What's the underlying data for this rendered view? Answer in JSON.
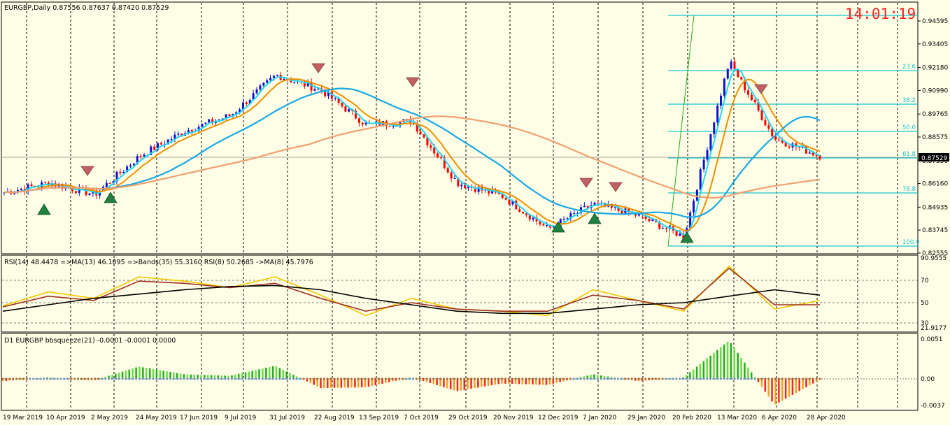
{
  "main": {
    "title": "EURGBP,Daily  0.87556 0.87637 0.87420 0.87529",
    "clock": "14:01:19",
    "current_price": "0.87529",
    "price_ticks": [
      "0.94595",
      "0.93405",
      "0.92180",
      "0.90990",
      "0.89765",
      "0.88575",
      "0.87350",
      "0.86160",
      "0.84935",
      "0.83745",
      "0.82555"
    ],
    "fib_levels": [
      "23.6",
      "38.2",
      "50.0",
      "61.8",
      "76.8",
      "100.0"
    ]
  },
  "rsi_panel": {
    "label": "RSI(14) 48.4478  =>MA(13) 46.1095  =>Bands(35) 55.3160  RSI(8) 50.2685  ->MA(8) 45.7976",
    "ticks": [
      "90.9555",
      "70",
      "50",
      "30",
      "21.9177"
    ]
  },
  "squeeze_panel": {
    "label": "D1 EURGBP bbsqueeze(21) -0.0001 -0.0001 0.0000",
    "ticks": [
      "0.0051",
      "0.00",
      "-0.0037"
    ]
  },
  "time_axis": [
    "19 Mar 2019",
    "10 Apr 2019",
    "2 May 2019",
    "24 May 2019",
    "17 Jun 2019",
    "9 Jul 2019",
    "31 Jul 2019",
    "22 Aug 2019",
    "13 Sep 2019",
    "7 Oct 2019",
    "29 Oct 2019",
    "20 Nov 2019",
    "12 Dec 2019",
    "7 Jan 2020",
    "29 Jan 2020",
    "20 Feb 2020",
    "13 Mar 2020",
    "6 Apr 2020",
    "28 Apr 2020"
  ],
  "colors": {
    "bull": "#1010d0",
    "bear": "#ff0000",
    "ma_fast": "#20d8f0",
    "ma_mid": "#f09000",
    "ma_long": "#1aa8e6",
    "ma_slow": "#f0a070",
    "fib": "#19c3d2",
    "rsi": "#f0c800",
    "rsi_ma": "#a03020",
    "rsi_bands": "#000000"
  },
  "chart_data": [
    {
      "type": "candlestick",
      "symbol": "EURGBP",
      "timeframe": "Daily",
      "ylim": [
        0.82555,
        0.94595
      ],
      "x": [
        "19 Mar 2019",
        "10 Apr 2019",
        "2 May 2019",
        "24 May 2019",
        "17 Jun 2019",
        "9 Jul 2019",
        "31 Jul 2019",
        "22 Aug 2019",
        "13 Sep 2019",
        "7 Oct 2019",
        "29 Oct 2019",
        "20 Nov 2019",
        "12 Dec 2019",
        "7 Jan 2020",
        "29 Jan 2020",
        "20 Feb 2020",
        "13 Mar 2020",
        "6 Apr 2020",
        "28 Apr 2020"
      ],
      "close": [
        0.857,
        0.862,
        0.856,
        0.876,
        0.889,
        0.897,
        0.918,
        0.91,
        0.892,
        0.894,
        0.862,
        0.855,
        0.838,
        0.851,
        0.845,
        0.834,
        0.925,
        0.885,
        0.876
      ]
    },
    {
      "type": "line",
      "title": "RSI(14)",
      "ylim": [
        21.9177,
        90.9555
      ],
      "x": [
        "19 Mar 2019",
        "10 Apr 2019",
        "2 May 2019",
        "24 May 2019",
        "17 Jun 2019",
        "9 Jul 2019",
        "31 Jul 2019",
        "22 Aug 2019",
        "13 Sep 2019",
        "7 Oct 2019",
        "29 Oct 2019",
        "20 Nov 2019",
        "12 Dec 2019",
        "7 Jan 2020",
        "29 Jan 2020",
        "20 Feb 2020",
        "13 Mar 2020",
        "6 Apr 2020",
        "28 Apr 2020"
      ],
      "series": [
        {
          "name": "RSI(8)",
          "values": [
            45,
            58,
            52,
            72,
            68,
            62,
            72,
            55,
            36,
            52,
            42,
            40,
            36,
            60,
            50,
            40,
            82,
            42,
            50
          ]
        },
        {
          "name": "MA(8)",
          "values": [
            44,
            54,
            50,
            68,
            66,
            62,
            66,
            52,
            40,
            48,
            42,
            40,
            40,
            55,
            50,
            42,
            80,
            46,
            46
          ]
        },
        {
          "name": "Bands(35)",
          "values": [
            40,
            46,
            52,
            56,
            60,
            63,
            64,
            60,
            52,
            46,
            40,
            38,
            38,
            42,
            46,
            48,
            54,
            60,
            55
          ]
        }
      ]
    },
    {
      "type": "bar",
      "title": "bbsqueeze(21)",
      "ylim": [
        -0.0037,
        0.0051
      ],
      "x": [
        "19 Mar 2019",
        "10 Apr 2019",
        "2 May 2019",
        "24 May 2019",
        "17 Jun 2019",
        "9 Jul 2019",
        "31 Jul 2019",
        "22 Aug 2019",
        "13 Sep 2019",
        "7 Oct 2019",
        "29 Oct 2019",
        "20 Nov 2019",
        "12 Dec 2019",
        "7 Jan 2020",
        "29 Jan 2020",
        "20 Feb 2020",
        "13 Mar 2020",
        "6 Apr 2020",
        "28 Apr 2020"
      ],
      "values": [
        -0.0003,
        0.0002,
        -0.0002,
        0.0016,
        0.0006,
        0.0004,
        0.0017,
        -0.0012,
        -0.0011,
        0.0002,
        -0.0016,
        -0.0006,
        -0.0008,
        0.0006,
        -0.0003,
        0.0002,
        0.005,
        -0.0034,
        -0.0001
      ]
    }
  ]
}
